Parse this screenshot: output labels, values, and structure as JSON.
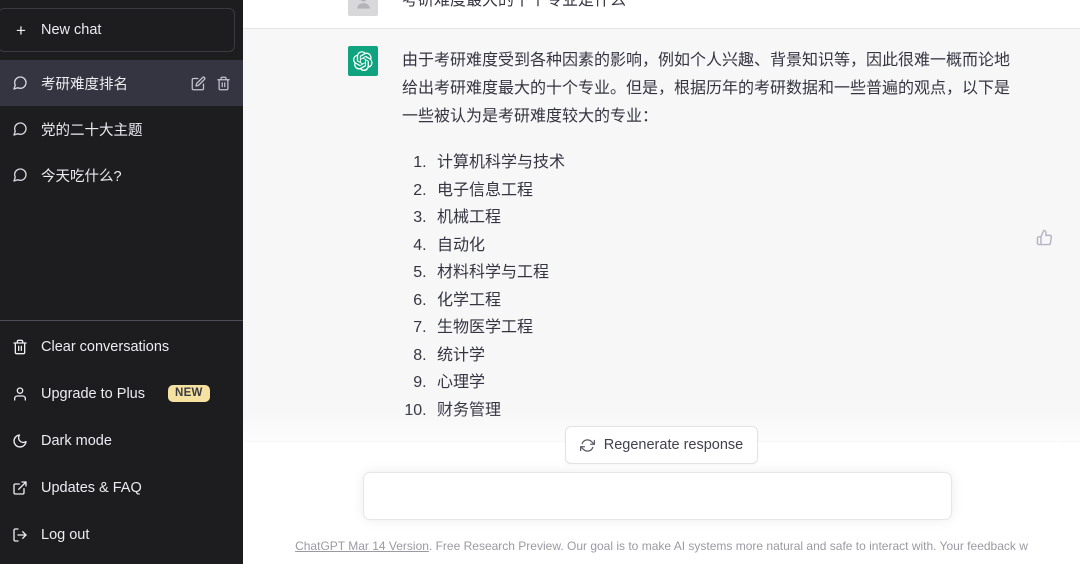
{
  "sidebar": {
    "new_chat": {
      "label": "New chat",
      "icon": "plus-icon"
    },
    "conversations": [
      {
        "label": "考研难度排名",
        "icon": "chat-bubble-icon",
        "active": true,
        "edit_icon": "pencil-icon",
        "delete_icon": "trash-icon"
      },
      {
        "label": "党的二十大主题",
        "icon": "chat-bubble-icon",
        "active": false
      },
      {
        "label": "今天吃什么?",
        "icon": "chat-bubble-icon",
        "active": false
      }
    ],
    "menu": [
      {
        "label": "Clear conversations",
        "icon": "trash-icon",
        "badge": ""
      },
      {
        "label": "Upgrade to Plus",
        "icon": "person-icon",
        "badge": "NEW"
      },
      {
        "label": "Dark mode",
        "icon": "moon-icon",
        "badge": ""
      },
      {
        "label": "Updates & FAQ",
        "icon": "external-link-icon",
        "badge": ""
      },
      {
        "label": "Log out",
        "icon": "logout-icon",
        "badge": ""
      }
    ],
    "badge_color": "#f6e2a0"
  },
  "main": {
    "messages": [
      {
        "role": "user",
        "avatar_icon": "user-avatar-icon",
        "text": "考研难度最大的十个专业是什么"
      },
      {
        "role": "assistant",
        "avatar_icon": "chatgpt-logo-icon",
        "text": "由于考研难度受到各种因素的影响，例如个人兴趣、背景知识等，因此很难一概而论地给出考研难度最大的十个专业。但是，根据历年的考研数据和一些普遍的观点，以下是一些被认为是考研难度较大的专业：",
        "list": [
          "计算机科学与技术",
          "电子信息工程",
          "机械工程",
          "自动化",
          "材料科学与工程",
          "化学工程",
          "生物医学工程",
          "统计学",
          "心理学",
          "财务管理"
        ],
        "action_icon": "thumbs-up-icon"
      }
    ],
    "accent_color": "#10a37f"
  },
  "bottom": {
    "regenerate": {
      "label": "Regenerate response",
      "icon": "refresh-icon"
    },
    "composer": {
      "value": "",
      "placeholder": ""
    },
    "footer": {
      "link": "ChatGPT Mar 14 Version",
      "rest": ". Free Research Preview. Our goal is to make AI systems more natural and safe to interact with. Your feedback w"
    }
  }
}
